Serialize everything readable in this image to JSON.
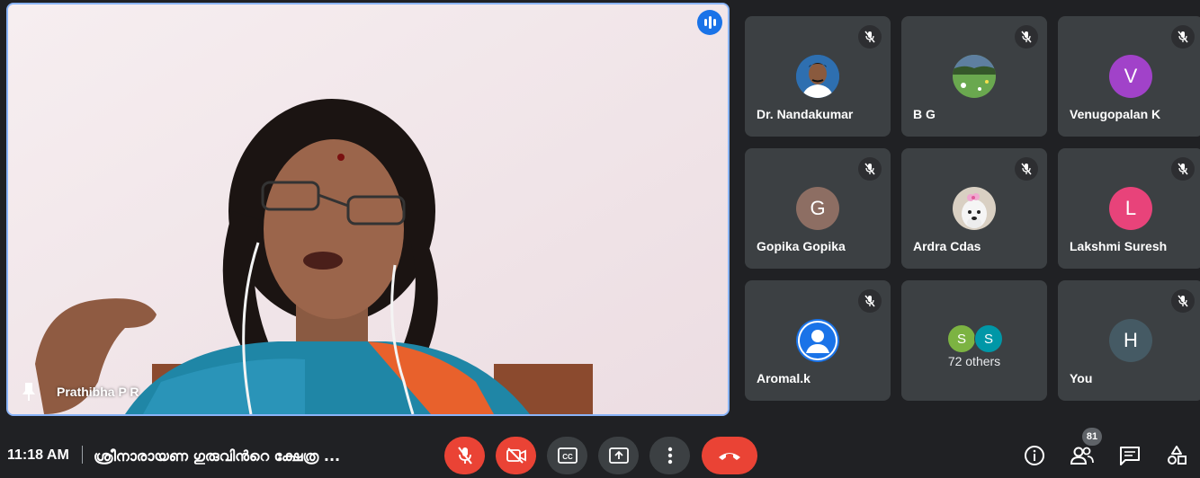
{
  "main_speaker": {
    "name": "Prathibha P R",
    "speaking": true
  },
  "participants": [
    {
      "name": "Dr. Nandakumar",
      "avatar_type": "photo",
      "avatar_desc": "man-portrait",
      "muted": true
    },
    {
      "name": "B G",
      "avatar_type": "photo",
      "avatar_desc": "green-landscape",
      "muted": true
    },
    {
      "name": "Venugopalan K",
      "avatar_type": "letter",
      "initial": "V",
      "color": "#a142c9",
      "muted": true
    },
    {
      "name": "Gopika Gopika",
      "avatar_type": "letter",
      "initial": "G",
      "color": "#8d6e63",
      "muted": true
    },
    {
      "name": "Ardra Cdas",
      "avatar_type": "photo",
      "avatar_desc": "dog-with-flower",
      "muted": true
    },
    {
      "name": "Lakshmi Suresh",
      "avatar_type": "letter",
      "initial": "L",
      "color": "#e8437a",
      "muted": true
    },
    {
      "name": "Aromal.k",
      "avatar_type": "default-person",
      "color": "#1a73e8",
      "muted": true
    }
  ],
  "others": {
    "label": "72 others",
    "mini_avatars": [
      {
        "initial": "S",
        "color": "#7cb342"
      },
      {
        "initial": "S",
        "color": "#0097a7"
      }
    ]
  },
  "self_tile": {
    "name": "You",
    "initial": "H",
    "color": "#455a64",
    "muted": true
  },
  "bottom_bar": {
    "time": "11:18 AM",
    "meeting_title": "ശ്രീനാരായണ ഗുരുവിൻറെ ക്ഷേത്ര ...",
    "controls": [
      {
        "icon": "mic-off-icon",
        "state": "red"
      },
      {
        "icon": "camera-off-icon",
        "state": "red"
      },
      {
        "icon": "captions-icon",
        "state": "gray"
      },
      {
        "icon": "present-screen-icon",
        "state": "gray"
      },
      {
        "icon": "more-options-icon",
        "state": "gray"
      },
      {
        "icon": "hang-up-icon",
        "state": "red"
      }
    ],
    "right_icons": [
      "info-icon",
      "people-icon",
      "chat-icon",
      "activities-icon"
    ],
    "people_count": "81"
  },
  "colors": {
    "background": "#202124",
    "tile": "#3c4043",
    "accent_blue": "#8ab4f8",
    "danger_red": "#ea4335"
  }
}
